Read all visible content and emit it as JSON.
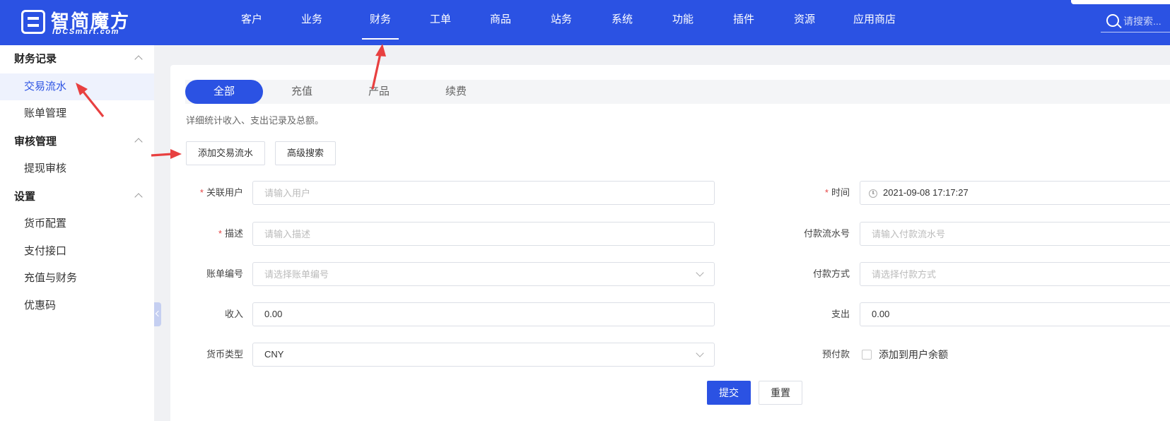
{
  "brand": {
    "name_cn": "智简魔方",
    "name_en": "IDCSmart.com"
  },
  "nav": {
    "items": [
      {
        "label": "客户"
      },
      {
        "label": "业务"
      },
      {
        "label": "财务"
      },
      {
        "label": "工单"
      },
      {
        "label": "商品"
      },
      {
        "label": "站务"
      },
      {
        "label": "系统"
      },
      {
        "label": "功能"
      },
      {
        "label": "插件"
      },
      {
        "label": "资源"
      },
      {
        "label": "应用商店"
      }
    ],
    "active": "财务",
    "search_placeholder": "请搜索..."
  },
  "sidebar": {
    "groups": [
      {
        "title": "财务记录",
        "items": [
          {
            "label": "交易流水"
          },
          {
            "label": "账单管理"
          }
        ]
      },
      {
        "title": "审核管理",
        "items": [
          {
            "label": "提现审核"
          }
        ]
      },
      {
        "title": "设置",
        "items": [
          {
            "label": "货币配置"
          },
          {
            "label": "支付接口"
          },
          {
            "label": "充值与财务"
          },
          {
            "label": "优惠码"
          }
        ]
      }
    ],
    "active_item": "交易流水"
  },
  "tabs": [
    {
      "label": "全部"
    },
    {
      "label": "充值"
    },
    {
      "label": "产品"
    },
    {
      "label": "续费"
    }
  ],
  "active_tab": "全部",
  "description": "详细统计收入、支出记录及总额。",
  "actions": {
    "add_label": "添加交易流水",
    "advanced_label": "高级搜索"
  },
  "form": {
    "user": {
      "label": "关联用户",
      "required": true,
      "placeholder": "请输入用户"
    },
    "time": {
      "label": "时间",
      "required": true,
      "value": "2021-09-08 17:17:27"
    },
    "description": {
      "label": "描述",
      "required": true,
      "placeholder": "请输入描述"
    },
    "payment_serial": {
      "label": "付款流水号",
      "placeholder": "请输入付款流水号"
    },
    "invoice_no": {
      "label": "账单编号",
      "placeholder": "请选择账单编号"
    },
    "payment_method": {
      "label": "付款方式",
      "placeholder": "请选择付款方式"
    },
    "income": {
      "label": "收入",
      "value": "0.00"
    },
    "expense": {
      "label": "支出",
      "value": "0.00"
    },
    "currency": {
      "label": "货币类型",
      "value": "CNY"
    },
    "prepay": {
      "label": "预付款",
      "checkbox_label": "添加到用户余额",
      "checked": false
    },
    "submit_label": "提交",
    "reset_label": "重置"
  },
  "colors": {
    "primary": "#2b52e3",
    "required": "#e54545",
    "annotation_arrow": "#e84040"
  }
}
